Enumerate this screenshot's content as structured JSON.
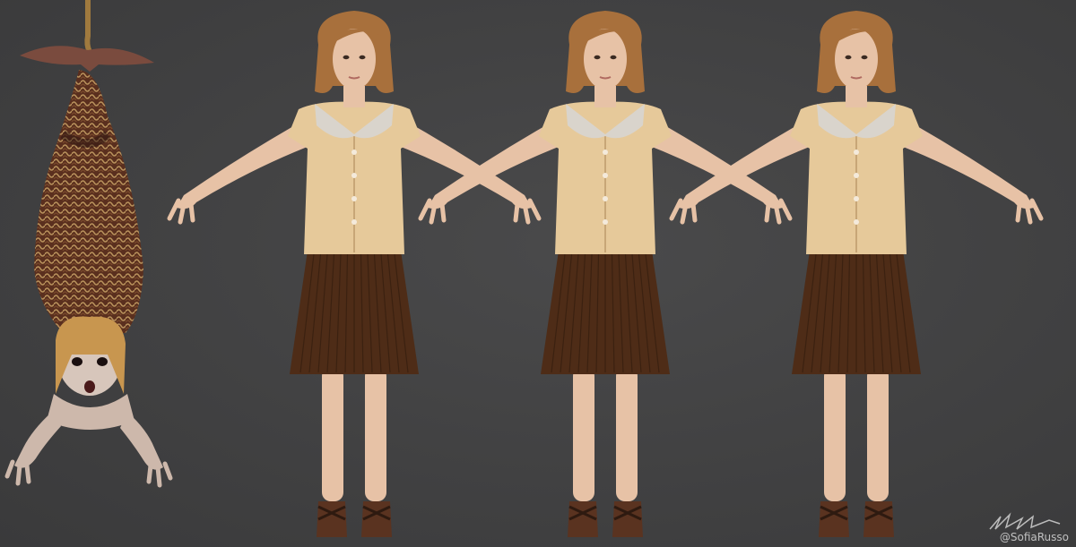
{
  "scene": {
    "background_color": "#414142",
    "watermark_handle": "@SofiaRusso"
  },
  "figures": [
    {
      "name": "inverted-creature",
      "skin": "#d7c6bb",
      "hair": "#c8964f",
      "fabric": "#6b3a26"
    },
    {
      "name": "girl-model",
      "skin": "#e7c2a6",
      "hair": "#a8703c",
      "blouse": "#e6c99a",
      "collar": "#d9d4cc",
      "skirt": "#4e2c17",
      "sandal": "#5a3320"
    },
    {
      "name": "girl-model",
      "skin": "#e7c2a6",
      "hair": "#a8703c",
      "blouse": "#e6c99a",
      "collar": "#d9d4cc",
      "skirt": "#4e2c17",
      "sandal": "#5a3320"
    },
    {
      "name": "girl-model",
      "skin": "#e7c2a6",
      "hair": "#a8703c",
      "blouse": "#e6c99a",
      "collar": "#d9d4cc",
      "skirt": "#4e2c17",
      "sandal": "#5a3320"
    }
  ]
}
